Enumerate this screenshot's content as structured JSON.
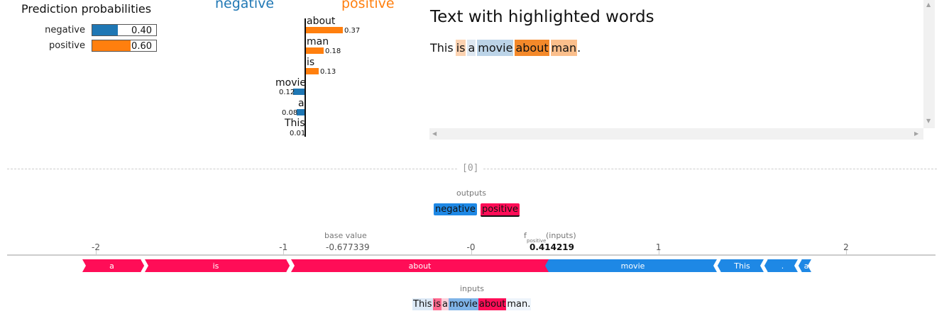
{
  "lime": {
    "prediction_title": "Prediction probabilities",
    "probabilities": [
      {
        "label": "negative",
        "value": 0.4,
        "display": "0.40",
        "color": "#1f77b4"
      },
      {
        "label": "positive",
        "value": 0.6,
        "display": "0.60",
        "color": "#ff7f0e"
      }
    ],
    "legend": {
      "negative": "negative",
      "positive": "positive"
    },
    "features": [
      {
        "word": "about",
        "value": "0.37",
        "side": "positive"
      },
      {
        "word": "man",
        "value": "0.18",
        "side": "positive"
      },
      {
        "word": "is",
        "value": "0.13",
        "side": "positive"
      },
      {
        "word": "movie",
        "value": "0.12",
        "side": "negative"
      },
      {
        "word": "a",
        "value": "0.08",
        "side": "negative"
      },
      {
        "word": "This",
        "value": "0.01",
        "side": "positive"
      }
    ],
    "highlight_title": "Text with highlighted words",
    "highlight_tokens": [
      {
        "text": "This",
        "bg": "transparent",
        "sep": " "
      },
      {
        "text": "is",
        "bg": "#fcd2b1",
        "sep": " "
      },
      {
        "text": "a",
        "bg": "#dde7f1",
        "sep": " "
      },
      {
        "text": "movie",
        "bg": "#bcd4e8",
        "sep": " "
      },
      {
        "text": "about",
        "bg": "#f4892a",
        "sep": " "
      },
      {
        "text": "man",
        "bg": "#fbbf8c",
        "sep": ""
      },
      {
        "text": ".",
        "bg": "transparent",
        "sep": ""
      }
    ]
  },
  "divider_label": "[0]",
  "shap": {
    "outputs_label": "outputs",
    "outputs": [
      {
        "label": "negative",
        "bg": "#1e88e5",
        "active": false
      },
      {
        "label": "positive",
        "bg": "#ff0d57",
        "active": true
      }
    ],
    "base_value_label": "base value",
    "base_value": "-0.677339",
    "f_label": "f",
    "f_sub": "positive",
    "f_inputs": "(inputs)",
    "f_value": "0.414219",
    "ticks": [
      "-2",
      "-1",
      "-0",
      "1",
      "2"
    ],
    "axis_min": -2,
    "axis_max": 2,
    "red_segments": [
      {
        "label": "a"
      },
      {
        "label": "is"
      },
      {
        "label": "about"
      }
    ],
    "blue_segments": [
      {
        "label": "movie"
      },
      {
        "label": "This"
      },
      {
        "label": "."
      },
      {
        "label": "a"
      }
    ],
    "inputs_label": "inputs",
    "input_tokens": [
      {
        "text": "This",
        "bg": "#dce9f6",
        "sep": ""
      },
      {
        "text": "is",
        "bg": "#ff6a8f",
        "sep": ""
      },
      {
        "text": "a",
        "bg": "#fbd1dc",
        "sep": ""
      },
      {
        "text": "movie",
        "bg": "#7fb4e8",
        "sep": ""
      },
      {
        "text": "about",
        "bg": "#ff0d57",
        "sep": ""
      },
      {
        "text": "man.",
        "bg": "#eef4fb",
        "sep": ""
      }
    ],
    "colors": {
      "positive": "#ff0d57",
      "negative": "#1e88e5"
    }
  }
}
